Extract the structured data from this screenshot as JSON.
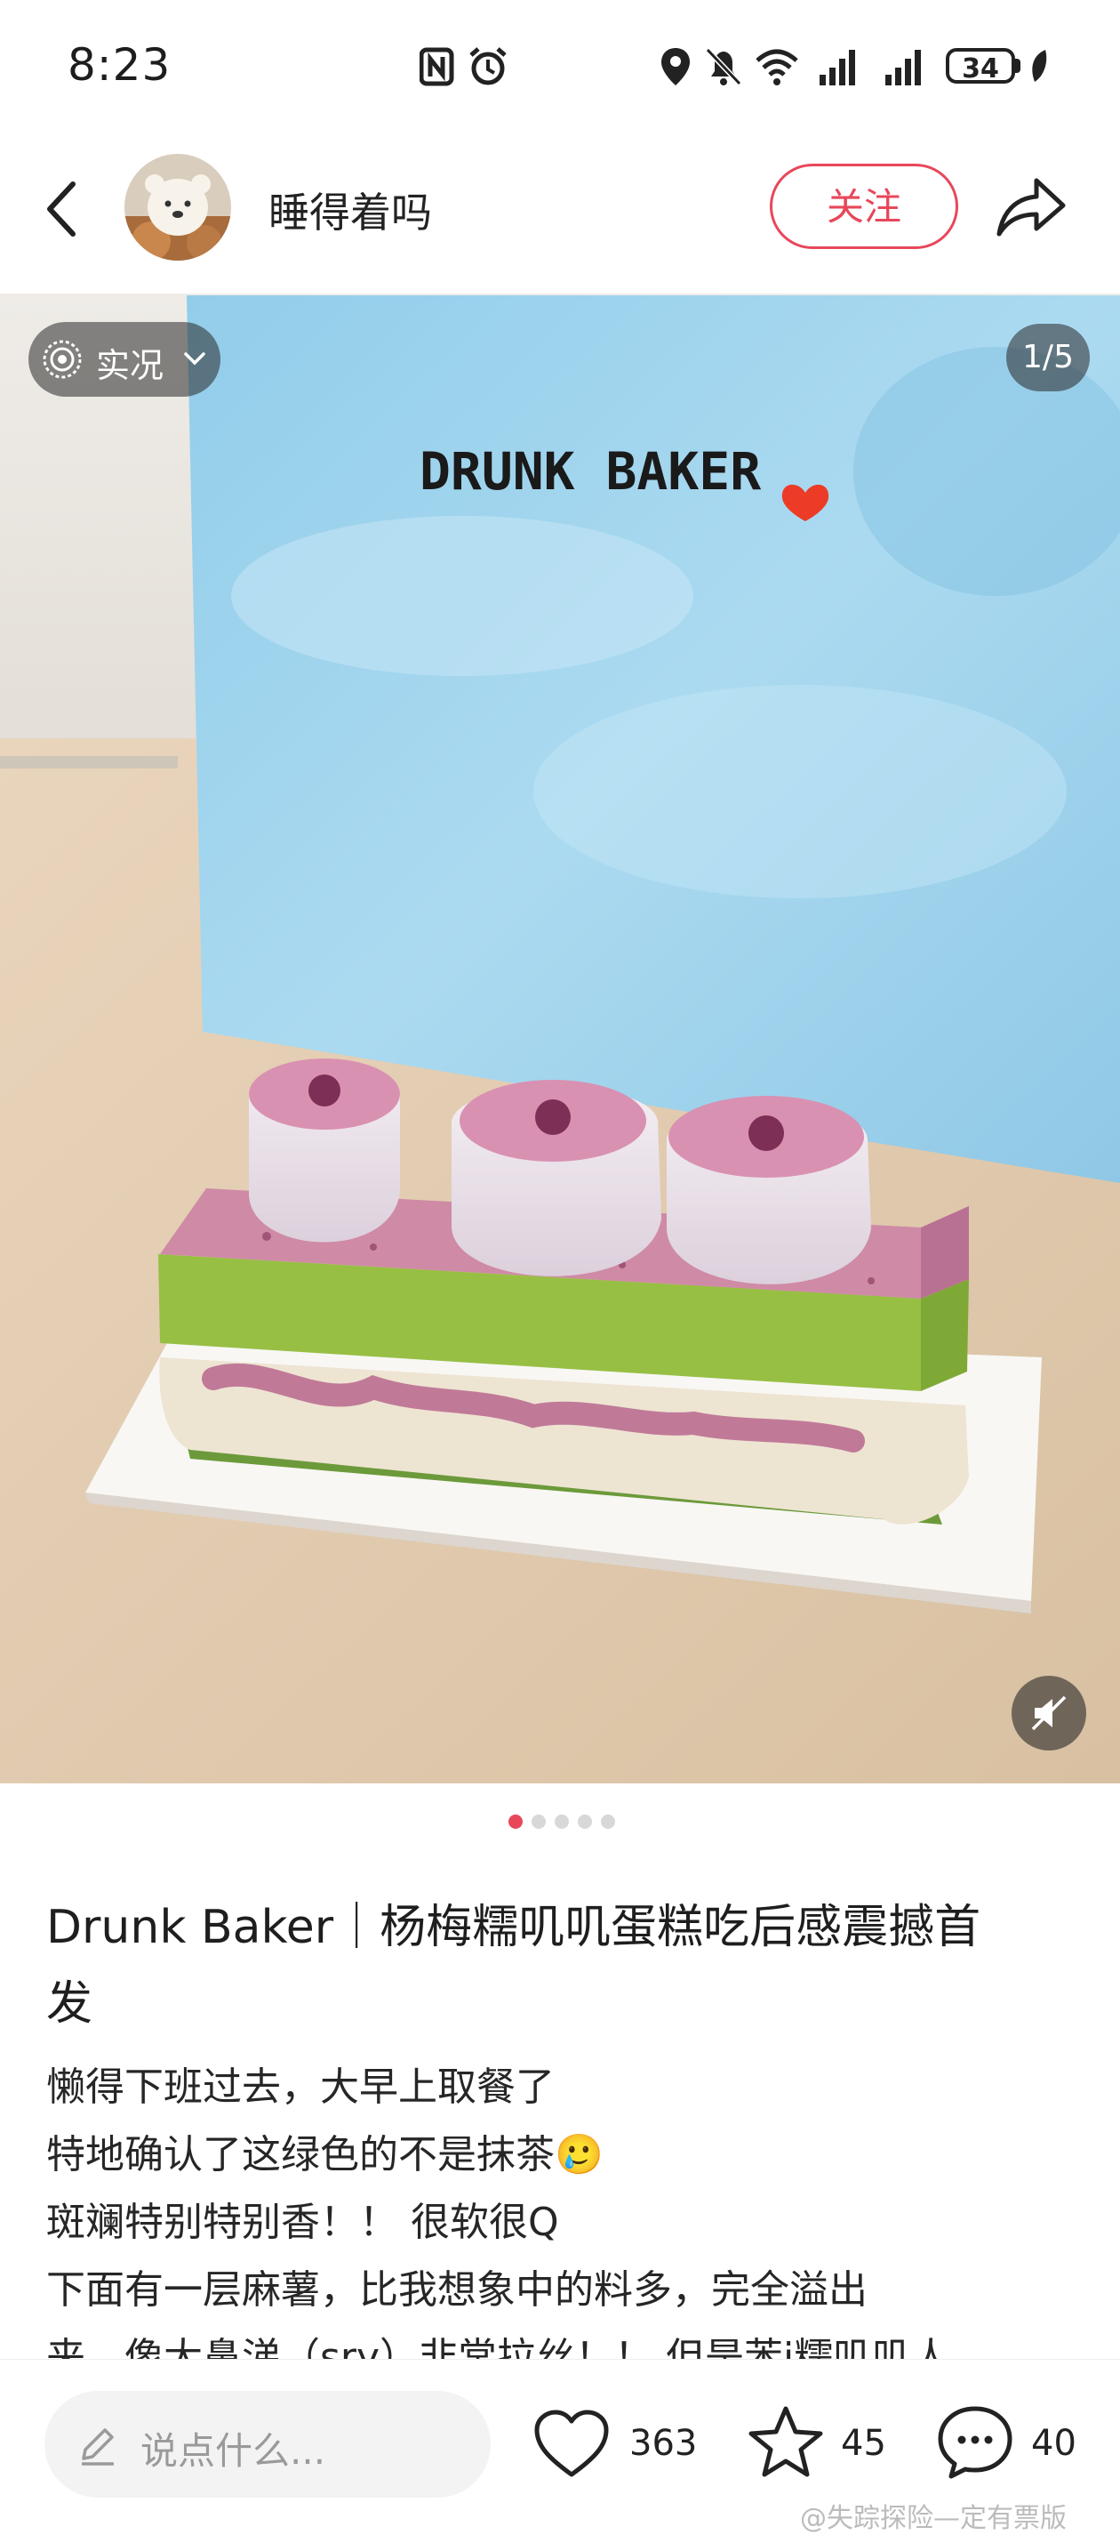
{
  "status_bar": {
    "time": "8:23",
    "battery": "34"
  },
  "header": {
    "author": "睡得着吗",
    "follow_label": "关注"
  },
  "photo": {
    "live_label": "实况",
    "counter": "1/5",
    "bag_text": "DRUNK BAKER"
  },
  "pager": {
    "total": 5,
    "active": 1
  },
  "post": {
    "title_line1": "Drunk Baker｜杨梅糯叽叽蛋糕吃后感震撼首",
    "title_line2": "发",
    "lines": [
      "懒得下班过去，大早上取餐了",
      "特地确认了这绿色的不是抹茶🥲",
      "斑斓特别特别香！！ 很软很Q",
      "下面有一层麻薯，比我想象中的料多，完全溢出",
      "来，像大鼻涕（sry）非常拉丝！！ 但是苯i糯叽叽人"
    ]
  },
  "bottom": {
    "comment_placeholder": "说点什么...",
    "likes": "363",
    "stars": "45",
    "comments": "40",
    "watermark": "@失踪探险—定有票版"
  },
  "colors": {
    "accent": "#e8475a",
    "sky": "#a8d6ee"
  }
}
